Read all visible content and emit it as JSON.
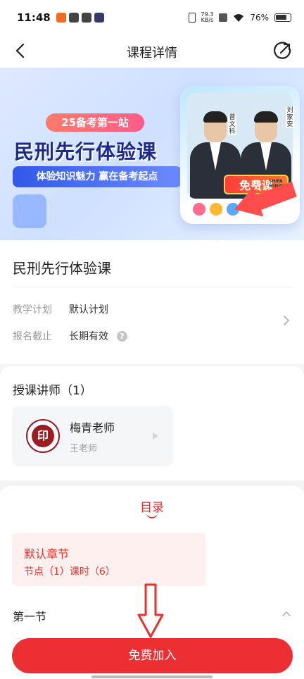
{
  "status": {
    "time": "11:48",
    "net_speed": "79.3",
    "net_unit": "KB/s",
    "battery": "76%"
  },
  "header": {
    "title": "课程详情",
    "back_icon": "back-arrow-icon",
    "share_icon": "share-icon"
  },
  "banner": {
    "tag": "25备考第一站",
    "headline": "民刑先行体验课",
    "subline": "体验知识魅力 赢在备考起点",
    "free_badge": "免费课",
    "teacher_a": "曾文科",
    "teacher_b": "刘家安",
    "brand": "SHIFA MINXING"
  },
  "course": {
    "title": "民刑先行体验课",
    "plan_label": "教学计划",
    "plan_value": "默认计划",
    "deadline_label": "报名截止",
    "deadline_value": "长期有效",
    "help_mark": "?"
  },
  "teachers": {
    "heading": "授课讲师（1）",
    "list": [
      {
        "name": "梅青老师",
        "sub": "王老师"
      }
    ]
  },
  "catalog": {
    "tab": "目录",
    "chapter_name": "默认章节",
    "chapter_stats": "节点（1）课时（6）",
    "section_name": "第一节"
  },
  "cta": {
    "label": "免费加入"
  },
  "colors": {
    "accent": "#ec2f33",
    "accent_light": "#fdf0ee"
  }
}
